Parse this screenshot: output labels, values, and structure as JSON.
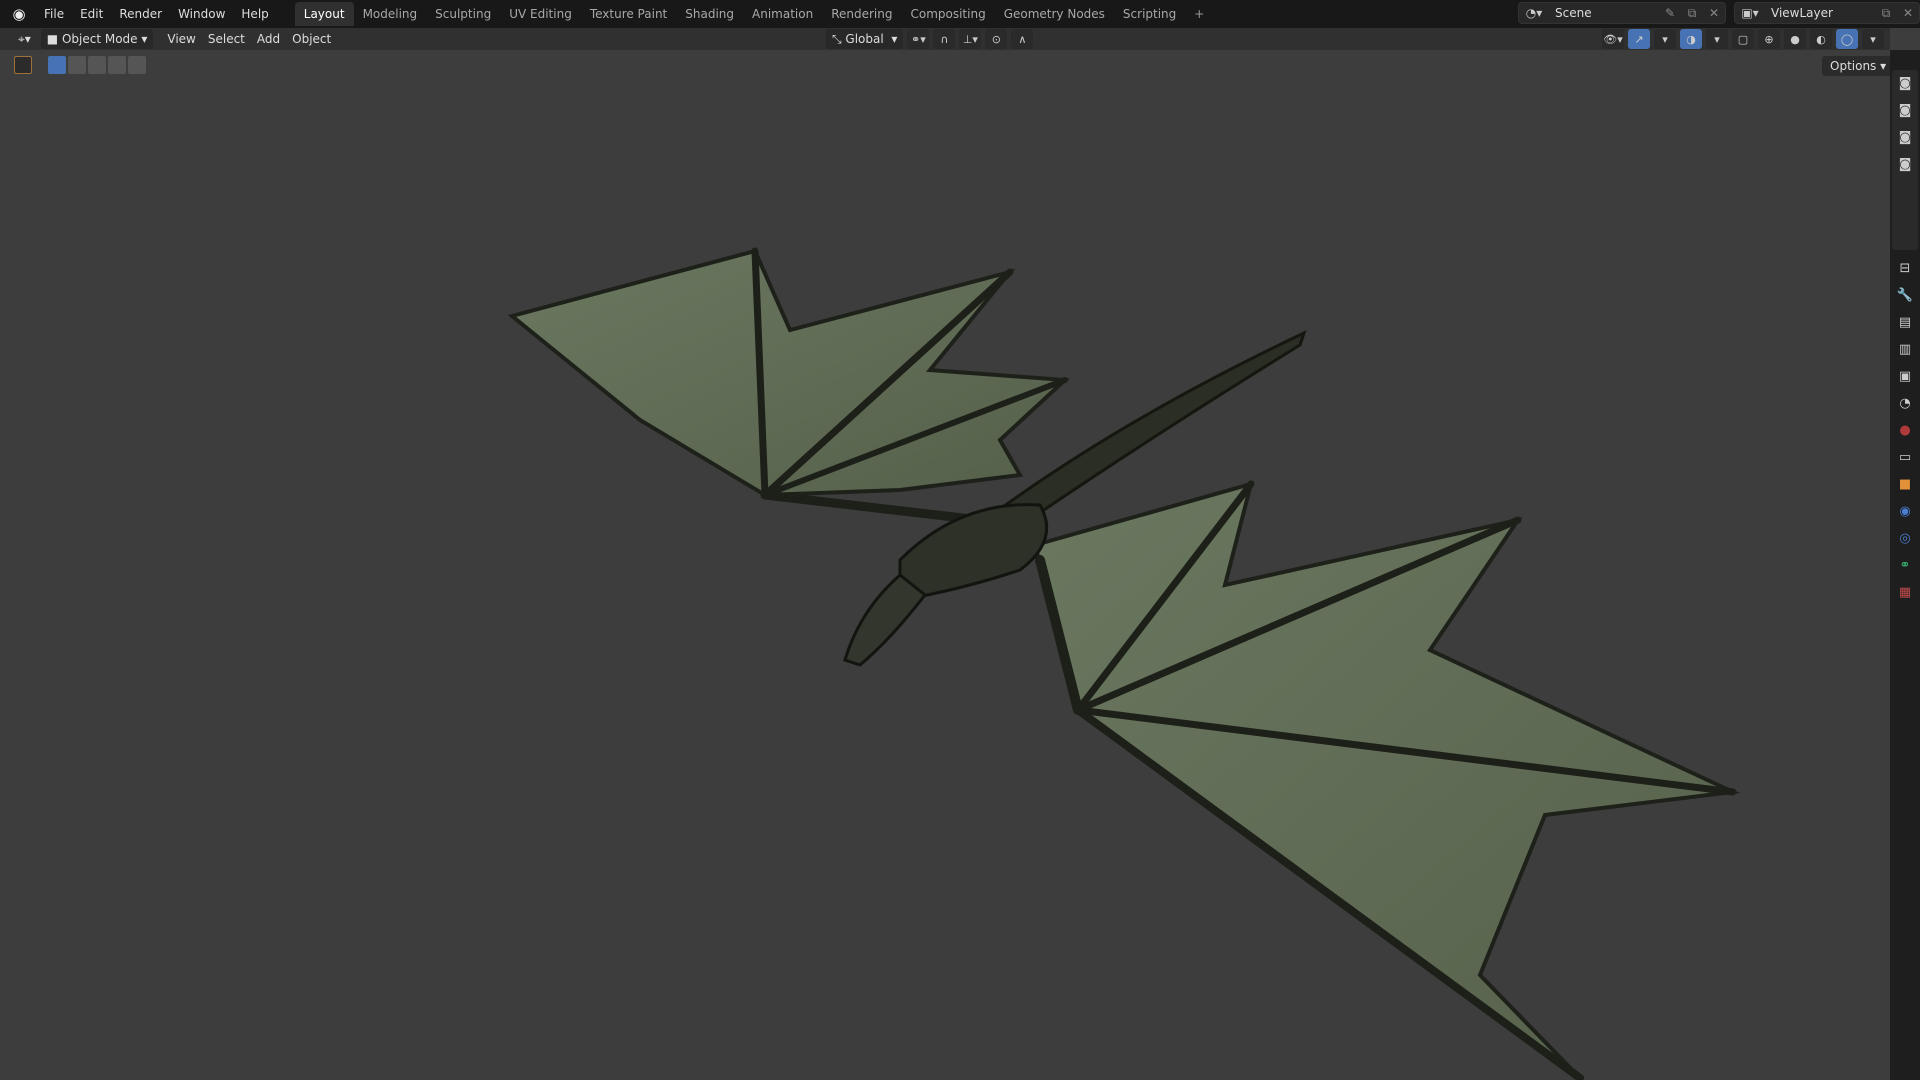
{
  "menu": [
    "File",
    "Edit",
    "Render",
    "Window",
    "Help"
  ],
  "workspaces": [
    "Layout",
    "Modeling",
    "Sculpting",
    "UV Editing",
    "Texture Paint",
    "Shading",
    "Animation",
    "Rendering",
    "Compositing",
    "Geometry Nodes",
    "Scripting"
  ],
  "active_workspace": "Layout",
  "add_workspace": "+",
  "scene": "Scene",
  "view_layer": "ViewLayer",
  "header": {
    "mode": "Object Mode",
    "view": "View",
    "select": "Select",
    "add": "Add",
    "object": "Object",
    "orientation": "Global",
    "options": "Options"
  },
  "colors": {
    "accent": "#4772b3",
    "viewport": "#3d3d3d",
    "wing": "#5f6b52"
  }
}
